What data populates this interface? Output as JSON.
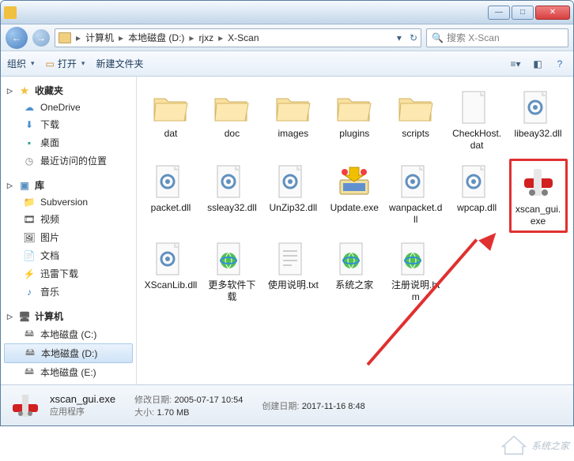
{
  "titlebar": {
    "title": ""
  },
  "breadcrumbs": {
    "items": [
      "计算机",
      "本地磁盘 (D:)",
      "rjxz",
      "X-Scan"
    ]
  },
  "search": {
    "placeholder": "搜索 X-Scan"
  },
  "toolbar": {
    "organize": "组织",
    "open": "打开",
    "newfolder": "新建文件夹"
  },
  "sidebar": {
    "favorites": {
      "label": "收藏夹",
      "items": [
        "OneDrive",
        "下载",
        "桌面",
        "最近访问的位置"
      ]
    },
    "libraries": {
      "label": "库",
      "items": [
        "Subversion",
        "视频",
        "图片",
        "文档",
        "迅雷下载",
        "音乐"
      ]
    },
    "computer": {
      "label": "计算机",
      "items": [
        "本地磁盘 (C:)",
        "本地磁盘 (D:)",
        "本地磁盘 (E:)"
      ]
    }
  },
  "files": [
    {
      "name": "dat",
      "type": "folder"
    },
    {
      "name": "doc",
      "type": "folder"
    },
    {
      "name": "images",
      "type": "folder"
    },
    {
      "name": "plugins",
      "type": "folder"
    },
    {
      "name": "scripts",
      "type": "folder"
    },
    {
      "name": "CheckHost.dat",
      "type": "dat"
    },
    {
      "name": "libeay32.dll",
      "type": "dll"
    },
    {
      "name": "packet.dll",
      "type": "dll"
    },
    {
      "name": "ssleay32.dll",
      "type": "dll"
    },
    {
      "name": "UnZip32.dll",
      "type": "dll"
    },
    {
      "name": "Update.exe",
      "type": "exe-update"
    },
    {
      "name": "wanpacket.dll",
      "type": "dll"
    },
    {
      "name": "wpcap.dll",
      "type": "dll"
    },
    {
      "name": "xscan_gui.exe",
      "type": "exe-xscan",
      "highlighted": true
    },
    {
      "name": "XScanLib.dll",
      "type": "dll"
    },
    {
      "name": "更多软件下载",
      "type": "html"
    },
    {
      "name": "使用说明.txt",
      "type": "txt"
    },
    {
      "name": "系统之家",
      "type": "html"
    },
    {
      "name": "注册说明.htm",
      "type": "html"
    }
  ],
  "details": {
    "filename": "xscan_gui.exe",
    "filetype": "应用程序",
    "mod_label": "修改日期:",
    "mod_value": "2005-07-17 10:54",
    "create_label": "创建日期:",
    "create_value": "2017-11-16 8:48",
    "size_label": "大小:",
    "size_value": "1.70 MB"
  },
  "watermark": {
    "text": "系统之家"
  }
}
